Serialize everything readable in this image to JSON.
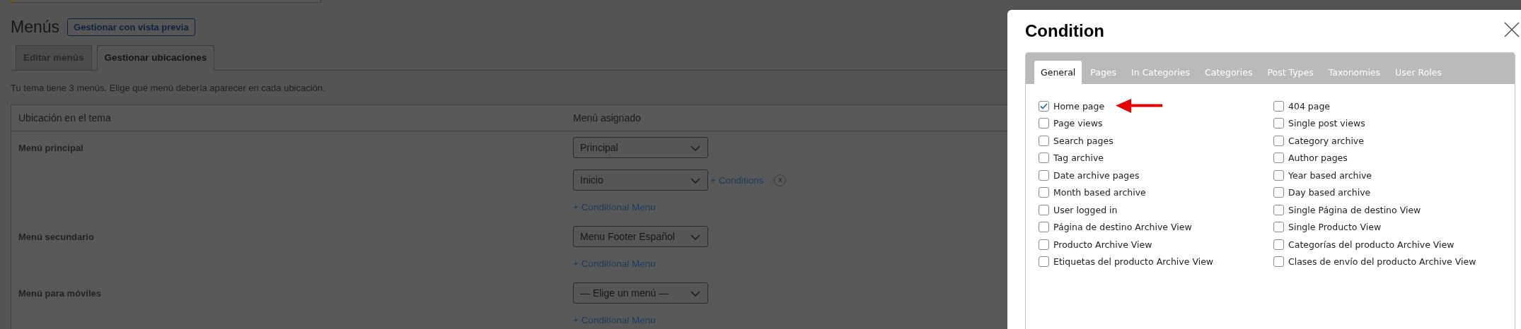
{
  "page": {
    "title": "Menús",
    "preview_button": "Gestionar con vista previa",
    "tabs": [
      {
        "label": "Editar menús",
        "selected": false
      },
      {
        "label": "Gestionar ubicaciones",
        "selected": true
      }
    ],
    "description": "Tu tema tiene 3 menús. Elige qué menú debería aparecer en cada ubicación.",
    "table": {
      "columns": [
        "Ubicación en el tema",
        "Menú asignado"
      ],
      "rows": [
        {
          "location": "Menú principal",
          "menus": [
            {
              "value": "Principal"
            },
            {
              "value": "Inicio",
              "conditions_link": "+ Conditions",
              "remove": "x"
            }
          ],
          "add_link": "+ Conditional Menu"
        },
        {
          "location": "Menú secundario",
          "menus": [
            {
              "value": "Menu Footer Español"
            }
          ],
          "add_link": "+ Conditional Menu"
        },
        {
          "location": "Menú para móviles",
          "menus": [
            {
              "value": "— Elige un menú —"
            }
          ],
          "add_link": "+ Conditional Menu"
        }
      ]
    }
  },
  "modal": {
    "title": "Condition",
    "tabs": [
      {
        "label": "General",
        "selected": true
      },
      {
        "label": "Pages",
        "selected": false
      },
      {
        "label": "In Categories",
        "selected": false
      },
      {
        "label": "Categories",
        "selected": false
      },
      {
        "label": "Post Types",
        "selected": false
      },
      {
        "label": "Taxonomies",
        "selected": false
      },
      {
        "label": "User Roles",
        "selected": false
      }
    ],
    "options": [
      {
        "label": "Home page",
        "checked": true
      },
      {
        "label": "Page views",
        "checked": false
      },
      {
        "label": "Search pages",
        "checked": false
      },
      {
        "label": "Tag archive",
        "checked": false
      },
      {
        "label": "Date archive pages",
        "checked": false
      },
      {
        "label": "Month based archive",
        "checked": false
      },
      {
        "label": "User logged in",
        "checked": false
      },
      {
        "label": "Página de destino Archive View",
        "checked": false
      },
      {
        "label": "Producto Archive View",
        "checked": false
      },
      {
        "label": "Etiquetas del producto Archive View",
        "checked": false
      },
      {
        "label": "404 page",
        "checked": false
      },
      {
        "label": "Single post views",
        "checked": false
      },
      {
        "label": "Category archive",
        "checked": false
      },
      {
        "label": "Author pages",
        "checked": false
      },
      {
        "label": "Year based archive",
        "checked": false
      },
      {
        "label": "Day based archive",
        "checked": false
      },
      {
        "label": "Single Página de destino View",
        "checked": false
      },
      {
        "label": "Single Producto View",
        "checked": false
      },
      {
        "label": "Categorías del producto Archive View",
        "checked": false
      },
      {
        "label": "Clases de envío del producto Archive View",
        "checked": false
      }
    ]
  }
}
